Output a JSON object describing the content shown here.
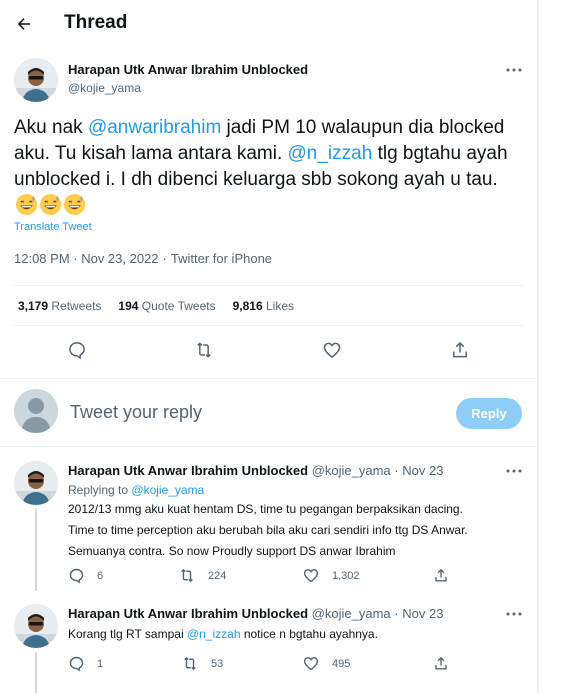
{
  "header": {
    "title": "Thread",
    "back_icon": "arrow-left-icon"
  },
  "main_tweet": {
    "author_name": "Harapan Utk Anwar Ibrahim Unblocked",
    "author_handle": "@kojie_yama",
    "text_parts": {
      "p1": "Aku nak ",
      "m1": "@anwaribrahim",
      "p2": " jadi PM 10 walaupun dia blocked aku. Tu kisah lama antara kami. ",
      "m2": "@n_izzah",
      "p3": " tlg bgtahu ayah unblocked i. I dh dibenci keluarga sbb sokong ayah u tau. "
    },
    "emoji_icons": [
      "grinning-sweat-emoji",
      "grinning-sweat-emoji",
      "grinning-sweat-emoji"
    ],
    "translate_label": "Translate Tweet",
    "timestamp": "12:08 PM · Nov 23, 2022",
    "separator": "·",
    "source": "Twitter for iPhone",
    "stats": {
      "retweets_count": "3,179",
      "retweets_label": "Retweets",
      "quotes_count": "194",
      "quotes_label": "Quote Tweets",
      "likes_count": "9,816",
      "likes_label": "Likes"
    }
  },
  "composer": {
    "placeholder": "Tweet your reply",
    "reply_button": "Reply"
  },
  "replies": [
    {
      "author_name": "Harapan Utk Anwar Ibrahim Unblocked",
      "author_handle": "@kojie_yama",
      "dot": "·",
      "date": "Nov 23",
      "replying_label": "Replying to",
      "replying_to": "@kojie_yama",
      "lines": [
        "2012/13 mmg aku kuat hentam DS, time tu pegangan berpaksikan dacing.",
        "Time to time perception aku berubah bila aku cari sendiri info ttg DS Anwar.",
        "Semuanya contra. So now Proudly support DS anwar Ibrahim"
      ],
      "replies": "6",
      "retweets": "224",
      "likes": "1,302"
    },
    {
      "author_name": "Harapan Utk Anwar Ibrahim Unblocked",
      "author_handle": "@kojie_yama",
      "dot": "·",
      "date": "Nov 23",
      "text_p1": "Korang tlg RT sampai ",
      "text_mention": "@n_izzah",
      "text_p2": " notice n bgtahu ayahnya.",
      "replies": "1",
      "retweets": "53",
      "likes": "495"
    }
  ],
  "colors": {
    "accent": "#1d9bf0",
    "reply_button_disabled": "#8ecdf8",
    "secondary_text": "#536471",
    "primary_text": "#0f1419",
    "divider": "#eff3f4"
  }
}
